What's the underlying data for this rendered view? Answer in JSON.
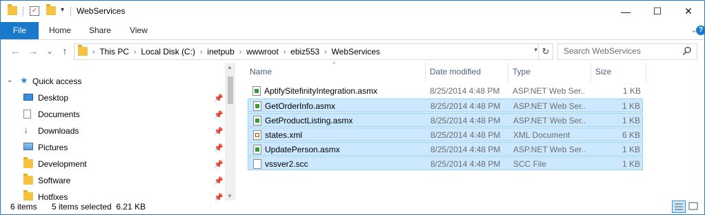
{
  "window": {
    "title": "WebServices",
    "minimize_symbol": "—",
    "maximize_symbol": "☐",
    "close_symbol": "✕"
  },
  "ribbon": {
    "tabs": [
      "File",
      "Home",
      "Share",
      "View"
    ],
    "expand_symbol": "⌄",
    "help_symbol": "?"
  },
  "address": {
    "crumbs": [
      "This PC",
      "Local Disk (C:)",
      "inetpub",
      "wwwroot",
      "ebiz553",
      "WebServices"
    ],
    "separator": "›",
    "dropdown_symbol": "▾",
    "refresh_symbol": "↻"
  },
  "search": {
    "placeholder": "Search WebServices"
  },
  "nav": {
    "back_symbol": "←",
    "forward_symbol": "→",
    "recent_symbol": "⌄",
    "up_symbol": "↑",
    "quick_access_label": "Quick access",
    "pin_symbol": "📌",
    "items": [
      {
        "label": "Desktop",
        "icon": "desktop-icon",
        "pinned": true
      },
      {
        "label": "Documents",
        "icon": "documents-icon",
        "pinned": true
      },
      {
        "label": "Downloads",
        "icon": "downloads-icon",
        "pinned": true
      },
      {
        "label": "Pictures",
        "icon": "pictures-icon",
        "pinned": true
      },
      {
        "label": "Development",
        "icon": "folder-icon",
        "pinned": true
      },
      {
        "label": "Software",
        "icon": "folder-icon",
        "pinned": true
      },
      {
        "label": "Hotfixes",
        "icon": "folder-icon",
        "pinned": true
      }
    ]
  },
  "columns": [
    "Name",
    "Date modified",
    "Type",
    "Size"
  ],
  "files": [
    {
      "name": "AptifySitefinityIntegration.asmx",
      "date": "8/25/2014 4:48 PM",
      "type": "ASP.NET Web Ser...",
      "size": "1 KB",
      "icon": "asmx",
      "selected": false
    },
    {
      "name": "GetOrderInfo.asmx",
      "date": "8/25/2014 4:48 PM",
      "type": "ASP.NET Web Ser...",
      "size": "1 KB",
      "icon": "asmx",
      "selected": true
    },
    {
      "name": "GetProductListing.asmx",
      "date": "8/25/2014 4:48 PM",
      "type": "ASP.NET Web Ser...",
      "size": "1 KB",
      "icon": "asmx",
      "selected": true
    },
    {
      "name": "states.xml",
      "date": "8/25/2014 4:48 PM",
      "type": "XML Document",
      "size": "6 KB",
      "icon": "xml",
      "selected": true
    },
    {
      "name": "UpdatePerson.asmx",
      "date": "8/25/2014 4:48 PM",
      "type": "ASP.NET Web Ser...",
      "size": "1 KB",
      "icon": "asmx",
      "selected": true
    },
    {
      "name": "vssver2.scc",
      "date": "8/25/2014 4:48 PM",
      "type": "SCC File",
      "size": "1 KB",
      "icon": "blank",
      "selected": true
    }
  ],
  "status": {
    "item_count": "6 items",
    "selection": "5 items selected  6.21 KB"
  },
  "colors": {
    "accent": "#1979ca",
    "selection_bg": "#cce8ff",
    "selection_border": "#99d1ff",
    "header_text": "#4c607a",
    "meta_text": "#6d6d6d"
  }
}
